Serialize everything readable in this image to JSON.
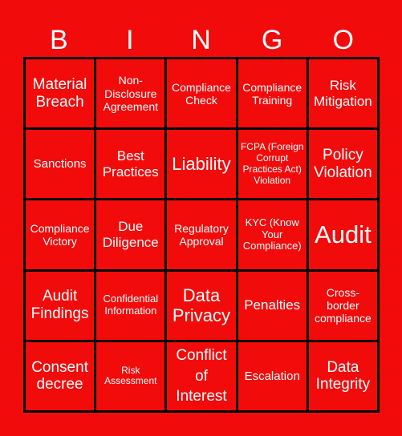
{
  "header": {
    "letters": [
      "B",
      "I",
      "N",
      "G",
      "O"
    ]
  },
  "card": {
    "rows": [
      [
        "Material Breach",
        "Non-Disclosure Agreement",
        "Compliance Check",
        "Compliance Training",
        "Risk Mitigation"
      ],
      [
        "Sanctions",
        "Best Practices",
        "Liability",
        "FCPA (Foreign Corrupt Practices Act) Violation",
        "Policy Violation"
      ],
      [
        "Compliance Victory",
        "Due Diligence",
        "Regulatory Approval",
        "KYC (Know Your Compliance)",
        "Audit"
      ],
      [
        "Audit Findings",
        "Confidential Information",
        "Data Privacy",
        "Penalties",
        "Cross-border compliance"
      ],
      [
        "Consent decree",
        "Risk Assessment",
        "Conflict of Interest",
        "Escalation",
        "Data Integrity"
      ]
    ]
  },
  "colors": {
    "background": "#f10b0b",
    "grid_lines": "#000000",
    "text": "#ffffff"
  }
}
